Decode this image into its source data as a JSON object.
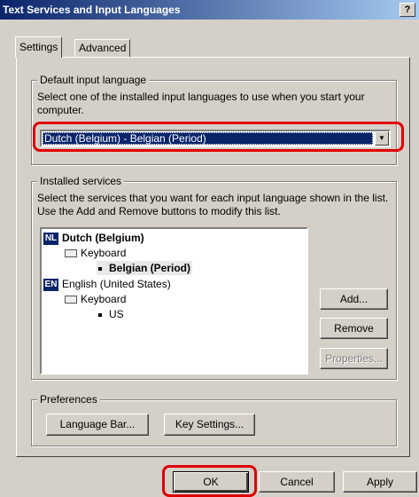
{
  "window": {
    "title": "Text Services and Input Languages",
    "help_label": "?",
    "close_label": "×"
  },
  "tabs": [
    {
      "label": "Settings"
    },
    {
      "label": "Advanced"
    }
  ],
  "default_input": {
    "legend": "Default input language",
    "description": "Select one of the installed input languages to use when you start your computer.",
    "selected": "Dutch (Belgium) - Belgian (Period)",
    "arrow": "▼"
  },
  "installed": {
    "legend": "Installed services",
    "description": "Select the services that you want for each input language shown in the list. Use the Add and Remove buttons to modify this list.",
    "languages": [
      {
        "code": "NL",
        "name": "Dutch (Belgium)",
        "service": "Keyboard",
        "layout": "Belgian (Period)"
      },
      {
        "code": "EN",
        "name": "English (United States)",
        "service": "Keyboard",
        "layout": "US"
      }
    ],
    "buttons": {
      "add": "Add...",
      "remove": "Remove",
      "properties": "Properties..."
    }
  },
  "preferences": {
    "legend": "Preferences",
    "language_bar": "Language Bar...",
    "key_settings": "Key Settings..."
  },
  "footer": {
    "ok": "OK",
    "cancel": "Cancel",
    "apply": "Apply"
  },
  "colors": {
    "highlight": "#e00000",
    "selection": "#0a246a",
    "face": "#d4d0c8"
  }
}
